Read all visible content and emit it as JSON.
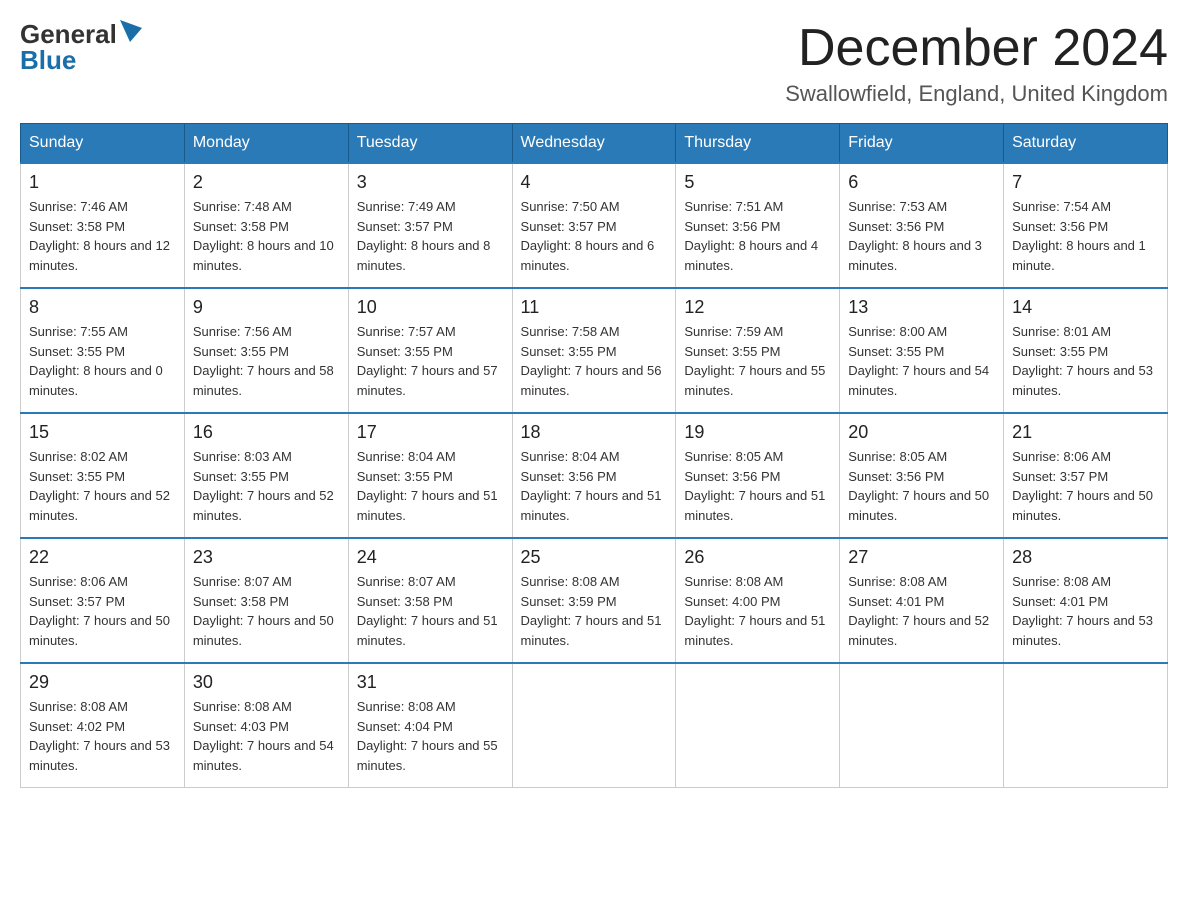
{
  "header": {
    "logo_general": "General",
    "logo_blue": "Blue",
    "month_title": "December 2024",
    "subtitle": "Swallowfield, England, United Kingdom"
  },
  "days_of_week": [
    "Sunday",
    "Monday",
    "Tuesday",
    "Wednesday",
    "Thursday",
    "Friday",
    "Saturday"
  ],
  "weeks": [
    [
      {
        "day": "1",
        "sunrise": "7:46 AM",
        "sunset": "3:58 PM",
        "daylight": "8 hours and 12 minutes."
      },
      {
        "day": "2",
        "sunrise": "7:48 AM",
        "sunset": "3:58 PM",
        "daylight": "8 hours and 10 minutes."
      },
      {
        "day": "3",
        "sunrise": "7:49 AM",
        "sunset": "3:57 PM",
        "daylight": "8 hours and 8 minutes."
      },
      {
        "day": "4",
        "sunrise": "7:50 AM",
        "sunset": "3:57 PM",
        "daylight": "8 hours and 6 minutes."
      },
      {
        "day": "5",
        "sunrise": "7:51 AM",
        "sunset": "3:56 PM",
        "daylight": "8 hours and 4 minutes."
      },
      {
        "day": "6",
        "sunrise": "7:53 AM",
        "sunset": "3:56 PM",
        "daylight": "8 hours and 3 minutes."
      },
      {
        "day": "7",
        "sunrise": "7:54 AM",
        "sunset": "3:56 PM",
        "daylight": "8 hours and 1 minute."
      }
    ],
    [
      {
        "day": "8",
        "sunrise": "7:55 AM",
        "sunset": "3:55 PM",
        "daylight": "8 hours and 0 minutes."
      },
      {
        "day": "9",
        "sunrise": "7:56 AM",
        "sunset": "3:55 PM",
        "daylight": "7 hours and 58 minutes."
      },
      {
        "day": "10",
        "sunrise": "7:57 AM",
        "sunset": "3:55 PM",
        "daylight": "7 hours and 57 minutes."
      },
      {
        "day": "11",
        "sunrise": "7:58 AM",
        "sunset": "3:55 PM",
        "daylight": "7 hours and 56 minutes."
      },
      {
        "day": "12",
        "sunrise": "7:59 AM",
        "sunset": "3:55 PM",
        "daylight": "7 hours and 55 minutes."
      },
      {
        "day": "13",
        "sunrise": "8:00 AM",
        "sunset": "3:55 PM",
        "daylight": "7 hours and 54 minutes."
      },
      {
        "day": "14",
        "sunrise": "8:01 AM",
        "sunset": "3:55 PM",
        "daylight": "7 hours and 53 minutes."
      }
    ],
    [
      {
        "day": "15",
        "sunrise": "8:02 AM",
        "sunset": "3:55 PM",
        "daylight": "7 hours and 52 minutes."
      },
      {
        "day": "16",
        "sunrise": "8:03 AM",
        "sunset": "3:55 PM",
        "daylight": "7 hours and 52 minutes."
      },
      {
        "day": "17",
        "sunrise": "8:04 AM",
        "sunset": "3:55 PM",
        "daylight": "7 hours and 51 minutes."
      },
      {
        "day": "18",
        "sunrise": "8:04 AM",
        "sunset": "3:56 PM",
        "daylight": "7 hours and 51 minutes."
      },
      {
        "day": "19",
        "sunrise": "8:05 AM",
        "sunset": "3:56 PM",
        "daylight": "7 hours and 51 minutes."
      },
      {
        "day": "20",
        "sunrise": "8:05 AM",
        "sunset": "3:56 PM",
        "daylight": "7 hours and 50 minutes."
      },
      {
        "day": "21",
        "sunrise": "8:06 AM",
        "sunset": "3:57 PM",
        "daylight": "7 hours and 50 minutes."
      }
    ],
    [
      {
        "day": "22",
        "sunrise": "8:06 AM",
        "sunset": "3:57 PM",
        "daylight": "7 hours and 50 minutes."
      },
      {
        "day": "23",
        "sunrise": "8:07 AM",
        "sunset": "3:58 PM",
        "daylight": "7 hours and 50 minutes."
      },
      {
        "day": "24",
        "sunrise": "8:07 AM",
        "sunset": "3:58 PM",
        "daylight": "7 hours and 51 minutes."
      },
      {
        "day": "25",
        "sunrise": "8:08 AM",
        "sunset": "3:59 PM",
        "daylight": "7 hours and 51 minutes."
      },
      {
        "day": "26",
        "sunrise": "8:08 AM",
        "sunset": "4:00 PM",
        "daylight": "7 hours and 51 minutes."
      },
      {
        "day": "27",
        "sunrise": "8:08 AM",
        "sunset": "4:01 PM",
        "daylight": "7 hours and 52 minutes."
      },
      {
        "day": "28",
        "sunrise": "8:08 AM",
        "sunset": "4:01 PM",
        "daylight": "7 hours and 53 minutes."
      }
    ],
    [
      {
        "day": "29",
        "sunrise": "8:08 AM",
        "sunset": "4:02 PM",
        "daylight": "7 hours and 53 minutes."
      },
      {
        "day": "30",
        "sunrise": "8:08 AM",
        "sunset": "4:03 PM",
        "daylight": "7 hours and 54 minutes."
      },
      {
        "day": "31",
        "sunrise": "8:08 AM",
        "sunset": "4:04 PM",
        "daylight": "7 hours and 55 minutes."
      },
      null,
      null,
      null,
      null
    ]
  ]
}
